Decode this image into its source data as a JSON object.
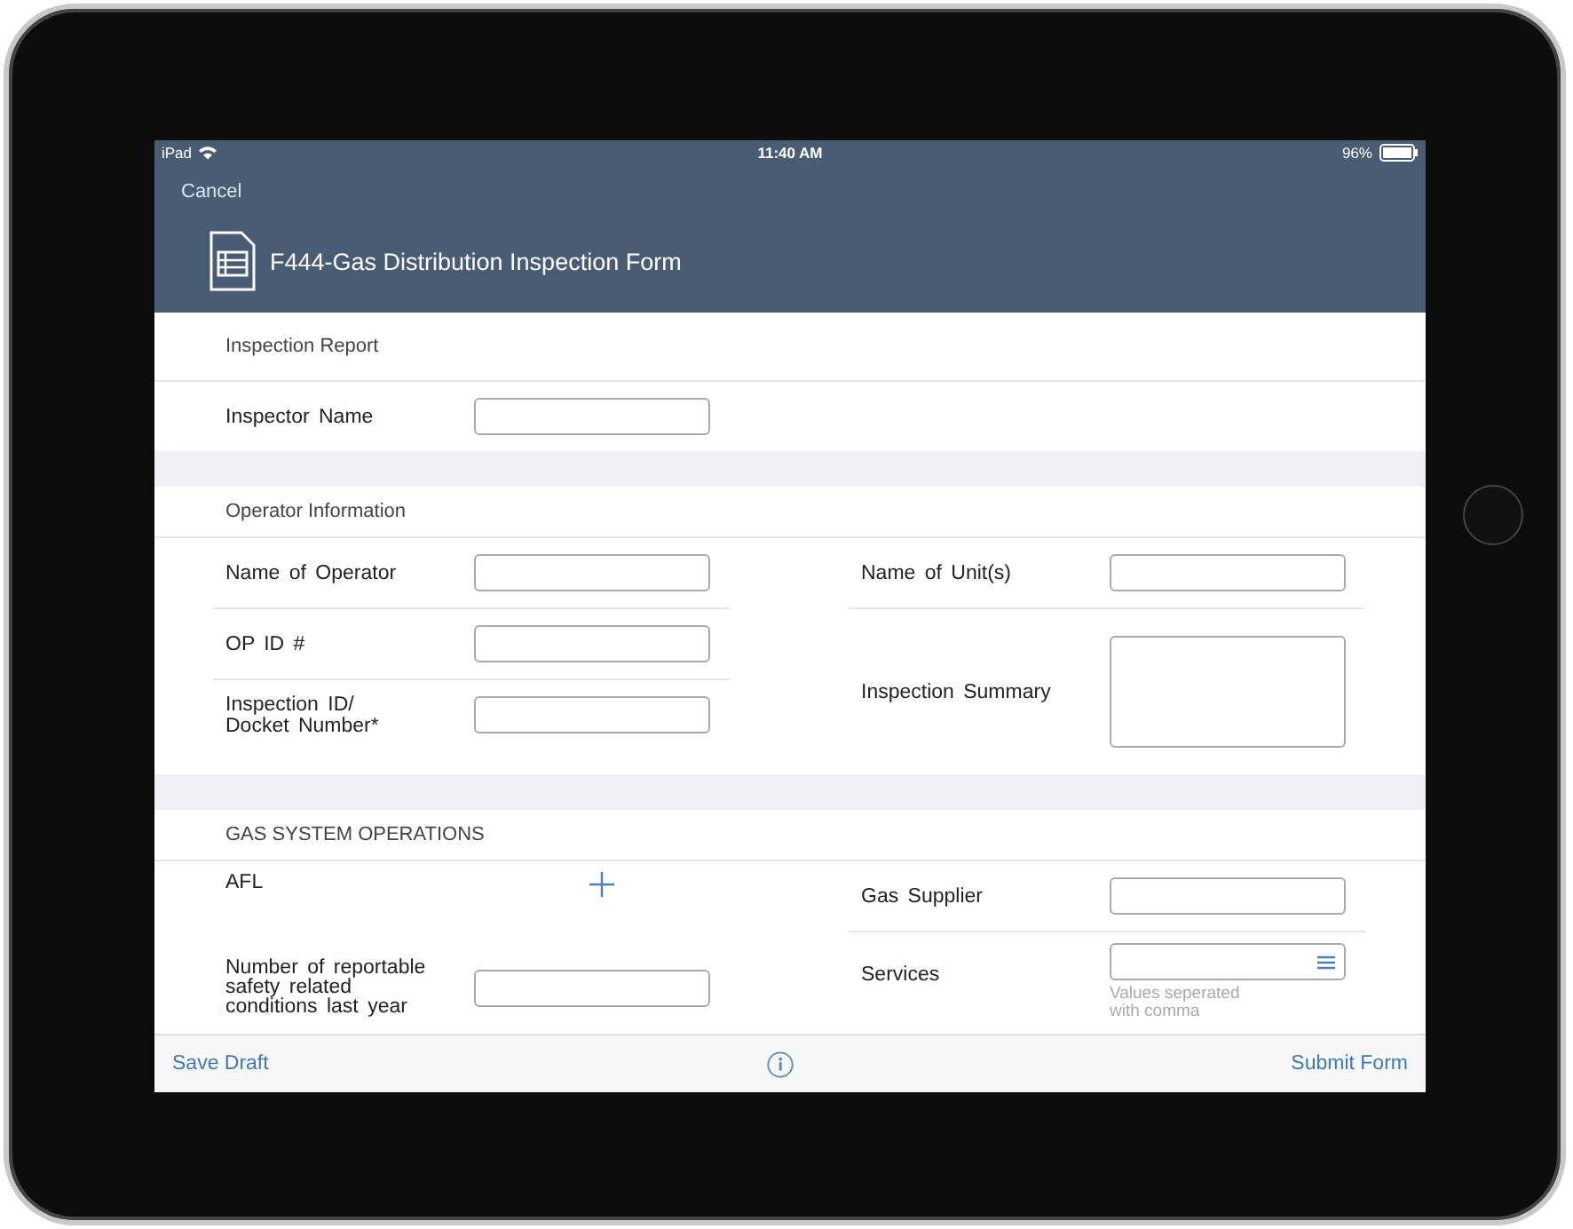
{
  "status_bar": {
    "device": "iPad",
    "time": "11:40 AM",
    "battery": "96%"
  },
  "nav": {
    "cancel": "Cancel",
    "title": "F444-Gas Distribution Inspection Form"
  },
  "sections": [
    {
      "title": "Inspection Report",
      "columns": [
        [
          {
            "kind": "text",
            "label": "Inspector Name"
          }
        ]
      ]
    },
    {
      "title": "Operator Information",
      "columns": [
        [
          {
            "kind": "text",
            "label": "Name of Operator"
          },
          {
            "kind": "text",
            "label": "OP ID #"
          },
          {
            "kind": "text",
            "label": "Inspection ID/\nDocket Number*"
          }
        ],
        [
          {
            "kind": "text",
            "label": "Name of Unit(s)"
          },
          {
            "kind": "textarea",
            "label": "Inspection Summary"
          }
        ]
      ]
    },
    {
      "title": "GAS SYSTEM OPERATIONS",
      "columns": [
        [
          {
            "kind": "add",
            "label": "AFL"
          },
          {
            "kind": "text",
            "label": "Number of reportable\nsafety related\nconditions last year"
          }
        ],
        [
          {
            "kind": "text",
            "label": "Gas Supplier"
          },
          {
            "kind": "multi",
            "label": "Services",
            "hint": "Values seperated\nwith comma"
          }
        ]
      ]
    }
  ],
  "footer": {
    "save": "Save Draft",
    "submit": "Submit Form"
  }
}
